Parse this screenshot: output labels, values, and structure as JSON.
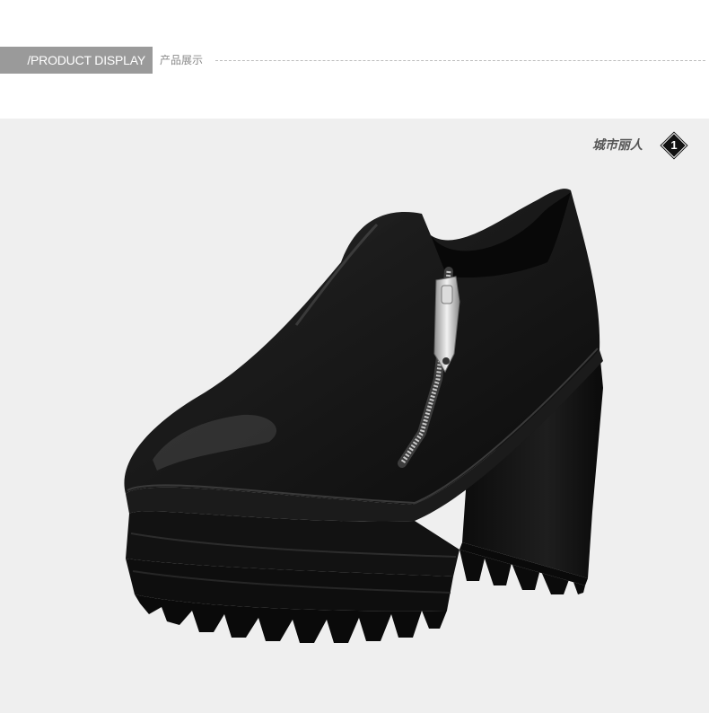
{
  "header": {
    "title": "/PRODUCT DISPLAY",
    "subtitle": "产品展示"
  },
  "photo": {
    "brand_text": "城市丽人",
    "badge_number": "1",
    "subject_icon": "platform-ankle-boot-with-side-zipper"
  },
  "colors": {
    "header_gray": "#9a9a9a",
    "photo_background": "#efefef",
    "boot_leather": "#141414"
  }
}
